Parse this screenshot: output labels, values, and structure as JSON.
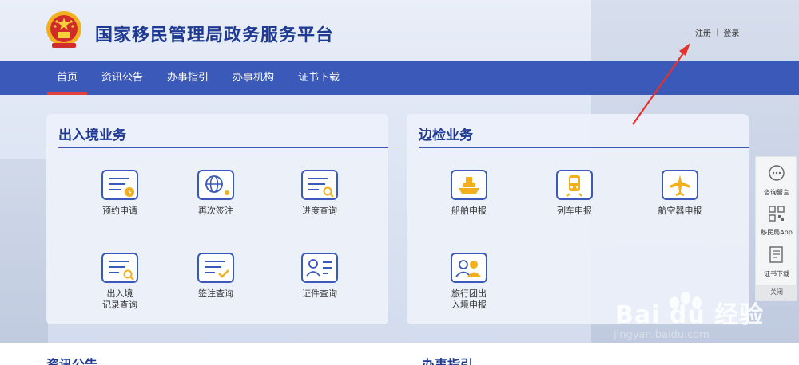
{
  "header": {
    "title": "国家移民管理局政务服务平台"
  },
  "top_links": {
    "register": "注册",
    "separator": "|",
    "login": "登录"
  },
  "nav": {
    "items": [
      {
        "label": "首页",
        "active": true
      },
      {
        "label": "资讯公告"
      },
      {
        "label": "办事指引"
      },
      {
        "label": "办事机构"
      },
      {
        "label": "证书下载"
      }
    ]
  },
  "entry_exit": {
    "title": "出入境业务",
    "services": [
      {
        "label": "预约申请",
        "icon": "appointment-icon"
      },
      {
        "label": "再次签注",
        "icon": "globe-icon"
      },
      {
        "label": "进度查询",
        "icon": "progress-search-icon"
      },
      {
        "label": "出入境\n记录查询",
        "icon": "record-search-icon"
      },
      {
        "label": "签注查询",
        "icon": "endorsement-check-icon"
      },
      {
        "label": "证件查询",
        "icon": "id-card-icon"
      }
    ]
  },
  "border": {
    "title": "边检业务",
    "services": [
      {
        "label": "船舶申报",
        "icon": "ship-icon"
      },
      {
        "label": "列车申报",
        "icon": "train-icon"
      },
      {
        "label": "航空器申报",
        "icon": "airplane-icon"
      },
      {
        "label": "旅行团出\n入境申报",
        "icon": "tour-group-icon"
      }
    ]
  },
  "sidebar": {
    "items": [
      {
        "label": "咨询留言",
        "icon": "chat-icon"
      },
      {
        "label": "移民局App",
        "icon": "qr-code-icon"
      },
      {
        "label": "证书下载",
        "icon": "certificate-icon"
      }
    ],
    "close": "关闭"
  },
  "sections": {
    "news": "资讯公告",
    "guide": "办事指引"
  },
  "watermark": {
    "brand": "Bai du 经验",
    "url": "jingyan.baidu.com"
  },
  "colors": {
    "nav": "#3a59b8",
    "title": "#1f3a93",
    "active_underline": "#e0413b",
    "icon_gold": "#f2b01e",
    "annotation_arrow": "#e5322d"
  }
}
